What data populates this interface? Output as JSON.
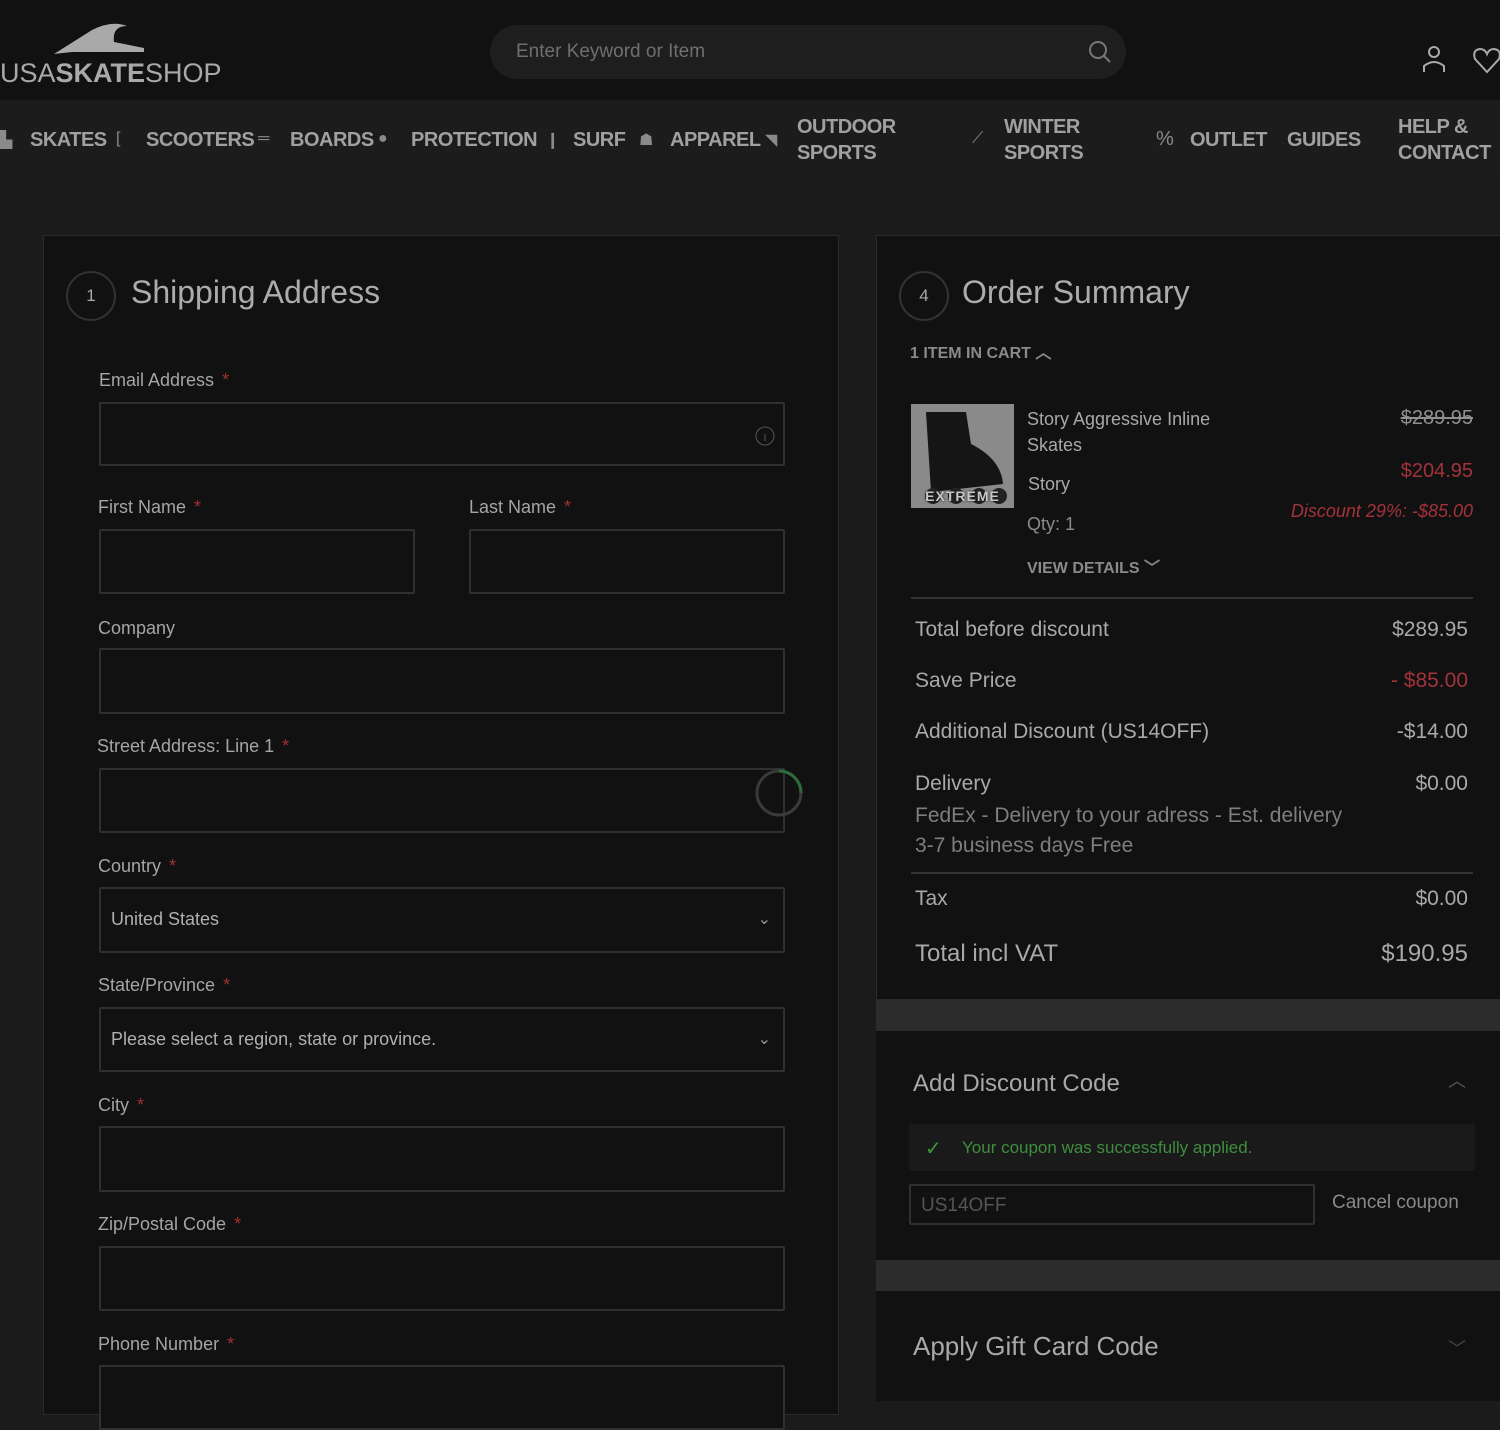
{
  "header": {
    "logo": {
      "usa": "USA",
      "skate": "SKATE",
      "shop": "SHOP"
    },
    "search_placeholder": "Enter Keyword or Item"
  },
  "nav": [
    {
      "label": "SKATES",
      "icon": "skate-icon"
    },
    {
      "label": "SCOOTERS",
      "icon": "scooter-icon"
    },
    {
      "label": "BOARDS",
      "icon": "board-icon"
    },
    {
      "label": "PROTECTION",
      "icon": "helmet-icon"
    },
    {
      "label": "SURF",
      "icon": "surfboard-icon"
    },
    {
      "label": "APPAREL",
      "icon": "hoodie-icon"
    },
    {
      "label": "OUTDOOR SPORTS",
      "icon": "outdoor-icon"
    },
    {
      "label": "WINTER SPORTS",
      "icon": "snowboard-icon"
    },
    {
      "label": "OUTLET",
      "icon": "percent-icon"
    },
    {
      "label": "GUIDES"
    },
    {
      "label": "HELP & CONTACT"
    }
  ],
  "shipping": {
    "step": "1",
    "title": "Shipping Address",
    "required_mark": "*",
    "fields": {
      "email": "Email Address",
      "first": "First Name",
      "last": "Last Name",
      "company": "Company",
      "street": "Street Address: Line 1",
      "country": "Country",
      "country_value": "United States",
      "state": "State/Province",
      "state_placeholder": "Please select a region, state or province.",
      "city": "City",
      "zip": "Zip/Postal Code",
      "phone": "Phone Number"
    }
  },
  "summary": {
    "step": "4",
    "title": "Order Summary",
    "items_toggle": "1 ITEM IN CART",
    "item": {
      "name": "Story Aggressive Inline Skates",
      "brand": "Story",
      "qty": "Qty: 1",
      "view_details": "VIEW DETAILS",
      "old_price": "$289.95",
      "price": "$204.95",
      "discount": "Discount 29%: -$85.00",
      "image_text": "EXTREME"
    },
    "rows": {
      "before_label": "Total before discount",
      "before": "$289.95",
      "save_label": "Save Price",
      "save": "- $85.00",
      "add_label": "Additional Discount (US14OFF)",
      "add": "-$14.00",
      "delivery_label": "Delivery",
      "delivery": "$0.00",
      "delivery_desc": "FedEx - Delivery to your adress - Est. delivery 3-7 business days Free",
      "tax_label": "Tax",
      "tax": "$0.00",
      "total_label": "Total incl VAT",
      "total": "$190.95"
    }
  },
  "discount": {
    "title": "Add Discount Code",
    "success": "Your coupon was successfully applied.",
    "code": "US14OFF",
    "cancel": "Cancel coupon"
  },
  "gift": {
    "title": "Apply Gift Card Code"
  }
}
